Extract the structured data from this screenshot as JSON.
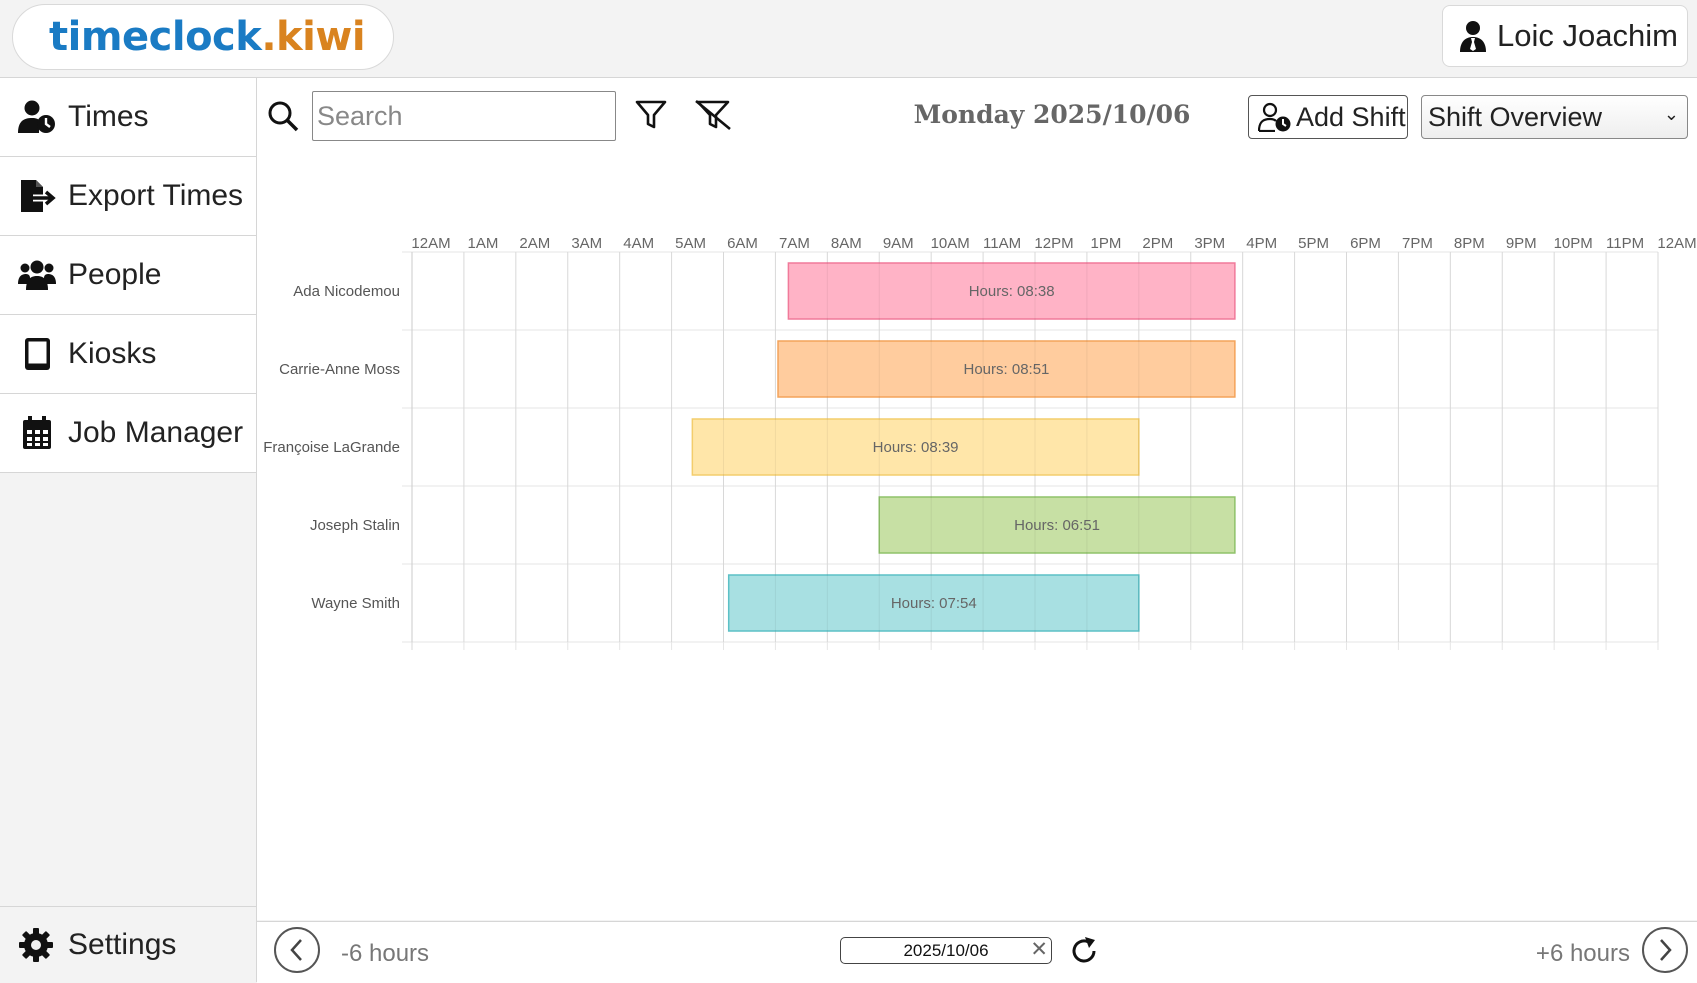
{
  "header": {
    "logo_part1": "timeclock",
    "logo_part2": ".kiwi",
    "user_name": "Loic Joachim"
  },
  "sidebar": {
    "items": [
      {
        "label": "Times",
        "icon": "user-clock-icon"
      },
      {
        "label": "Export Times",
        "icon": "file-export-icon"
      },
      {
        "label": "People",
        "icon": "users-icon"
      },
      {
        "label": "Kiosks",
        "icon": "tablet-icon"
      },
      {
        "label": "Job Manager",
        "icon": "calendar-icon"
      }
    ],
    "settings_label": "Settings"
  },
  "toolbar": {
    "search_placeholder": "Search",
    "date_title": "Monday 2025/10/06",
    "add_shift_label": "Add Shift",
    "view_selected": "Shift Overview"
  },
  "footer": {
    "prev_label": "-6 hours",
    "next_label": "+6 hours",
    "date_value": "2025/10/06"
  },
  "chart_data": {
    "type": "gantt",
    "x_ticks": [
      "12AM",
      "1AM",
      "2AM",
      "3AM",
      "4AM",
      "5AM",
      "6AM",
      "7AM",
      "8AM",
      "9AM",
      "10AM",
      "11AM",
      "12PM",
      "1PM",
      "2PM",
      "3PM",
      "4PM",
      "5PM",
      "6PM",
      "7PM",
      "8PM",
      "9PM",
      "10PM",
      "11PM",
      "12AM"
    ],
    "xlim": [
      0,
      24
    ],
    "grid": true,
    "rows": [
      {
        "name": "Ada Nicodemou",
        "start": 7.25,
        "end": 15.85,
        "label": "Hours: 08:38",
        "fill": "#ffb3c6",
        "stroke": "#f07a9a"
      },
      {
        "name": "Carrie-Anne Moss",
        "start": 7.05,
        "end": 15.85,
        "label": "Hours: 08:51",
        "fill": "#ffcc9e",
        "stroke": "#f4a35a"
      },
      {
        "name": "Françoise LaGrande",
        "start": 5.4,
        "end": 14.0,
        "label": "Hours: 08:39",
        "fill": "#ffe6a9",
        "stroke": "#f3cd6c"
      },
      {
        "name": "Joseph Stalin",
        "start": 9.0,
        "end": 15.85,
        "label": "Hours: 06:51",
        "fill": "#c7e0a4",
        "stroke": "#8fc26a"
      },
      {
        "name": "Wayne Smith",
        "start": 6.1,
        "end": 14.0,
        "label": "Hours: 07:54",
        "fill": "#a8e0e2",
        "stroke": "#5cc0c6"
      }
    ]
  }
}
